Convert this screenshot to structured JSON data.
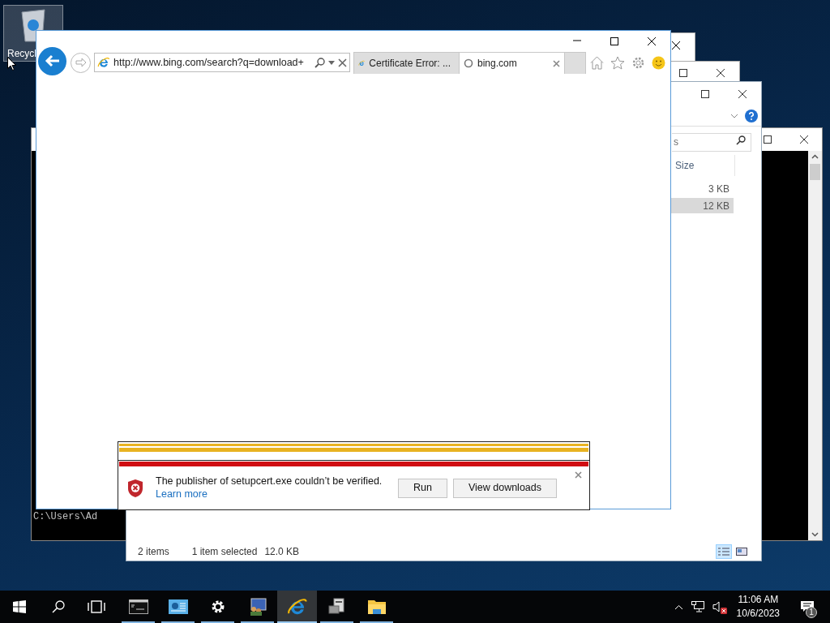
{
  "desktop": {
    "icons": [
      {
        "label": "Recycl",
        "selected": true
      }
    ]
  },
  "console": {
    "lines": [
      "C:\\Users\\Ad"
    ]
  },
  "explorer": {
    "search": {
      "placeholder": "s"
    },
    "columns": [
      "Size"
    ],
    "rows": [
      {
        "size": "3 KB",
        "selected": false
      },
      {
        "size": "12 KB",
        "selected": true
      }
    ],
    "status": {
      "item_count": "2 items",
      "selection": "1 item selected",
      "selection_size": "12.0 KB"
    },
    "views": [
      {
        "kind": "details",
        "selected": true
      },
      {
        "kind": "tiles",
        "selected": false
      }
    ]
  },
  "browser": {
    "address": "http://www.bing.com/search?q=download+",
    "tabs": [
      {
        "title": "Certificate Error: ...",
        "selected": false,
        "loading": false
      },
      {
        "title": "bing.com",
        "selected": true,
        "loading": true
      }
    ],
    "notification": {
      "message": "The publisher of setupcert.exe couldn’t be verified.",
      "link": "Learn more",
      "buttons": [
        "Run",
        "View downloads"
      ]
    }
  },
  "taskbar": {
    "apps": [
      {
        "kind": "console",
        "active": false
      },
      {
        "kind": "server-manager",
        "active": false
      },
      {
        "kind": "settings",
        "active": false
      },
      {
        "kind": "admin",
        "active": false
      },
      {
        "kind": "browser",
        "active": true
      },
      {
        "kind": "drive",
        "active": false
      },
      {
        "kind": "folder",
        "active": false
      }
    ],
    "volume": {
      "muted": true
    },
    "clock": {
      "time": "11:06 AM",
      "date": "10/6/2023"
    },
    "notifications": {
      "count": "1"
    }
  }
}
